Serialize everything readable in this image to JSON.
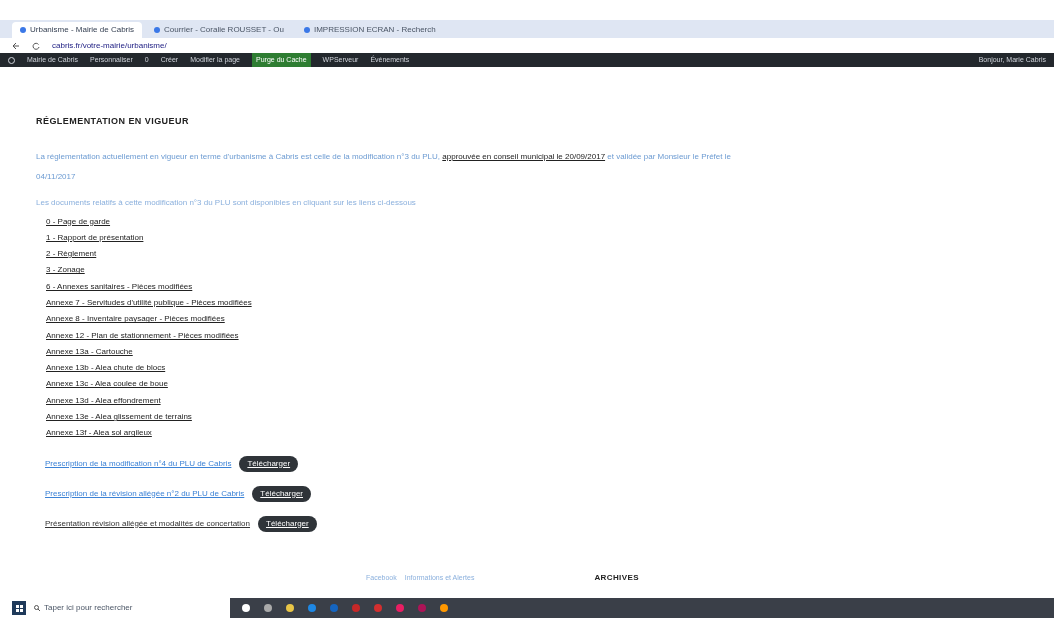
{
  "browser": {
    "tabs": [
      {
        "label": "Urbanisme - Mairie de Cabris",
        "selected": true
      },
      {
        "label": "Courrier - Coralie ROUSSET - Ou",
        "selected": false
      },
      {
        "label": "IMPRESSION ECRAN - Recherch",
        "selected": false
      }
    ],
    "address": "cabris.fr/votre-mairie/urbanisme/"
  },
  "admin_bar": {
    "items": [
      {
        "label": "Mairie de Cabris",
        "kind": "plain"
      },
      {
        "label": "Personnaliser",
        "kind": "plain"
      },
      {
        "label": "0",
        "kind": "plain"
      },
      {
        "label": "Créer",
        "kind": "plain"
      },
      {
        "label": "Modifier la page",
        "kind": "plain"
      },
      {
        "label": "Purge du Cache",
        "kind": "accent"
      },
      {
        "label": "WPServeur",
        "kind": "plain"
      },
      {
        "label": "Événements",
        "kind": "plain"
      }
    ],
    "greeting": "Bonjour, Marie Cabris"
  },
  "page": {
    "heading": "RÉGLEMENTATION EN VIGUEUR",
    "intro": {
      "before": "La réglementation actuellement en vigueur en terme d'urbanisme à Cabris est celle de la modification n°3 du PLU,",
      "link": "approuvée en conseil municipal le 20/09/2017",
      "after": "et validée par Monsieur le Préfet le 04/11/2017"
    },
    "documents_intro": "Les documents relatifs à cette modification n°3 du PLU sont disponibles en cliquant sur les liens ci-dessous",
    "documents": [
      "0 - Page de garde",
      "1 - Rapport de présentation",
      "2 - Règlement",
      "3 - Zonage",
      "6 - Annexes sanitaires - Pièces modifiées",
      "Annexe 7 - Servitudes d'utilité publique - Pièces modifiées",
      "Annexe 8 - Inventaire paysager - Pièces modifiées",
      "Annexe 12 - Plan de stationnement - Pièces modifiées",
      "Annexe 13a - Cartouche",
      "Annexe 13b - Alea chute de blocs",
      "Annexe 13c - Alea coulee de boue",
      "Annexe 13d - Alea effondrement",
      "Annexe 13e - Alea glissement de terrains",
      "Annexe 13f - Alea sol argileux"
    ],
    "downloads": [
      {
        "label": "Prescription de la modification n°4 du PLU de Cabris",
        "kind": "blue",
        "button": "Télécharger"
      },
      {
        "label": "Prescription de la révision allégée n°2 du PLU de Cabris",
        "kind": "blue",
        "button": "Télécharger"
      },
      {
        "label": "Présentation révision allégée et modalités de concertation",
        "kind": "dark",
        "button": "Télécharger"
      }
    ],
    "footer_links": [
      "Facebook",
      "Informations et Alertes"
    ],
    "footer_heading": "ARCHIVES"
  },
  "taskbar": {
    "search_placeholder": "Taper ici pour rechercher"
  }
}
